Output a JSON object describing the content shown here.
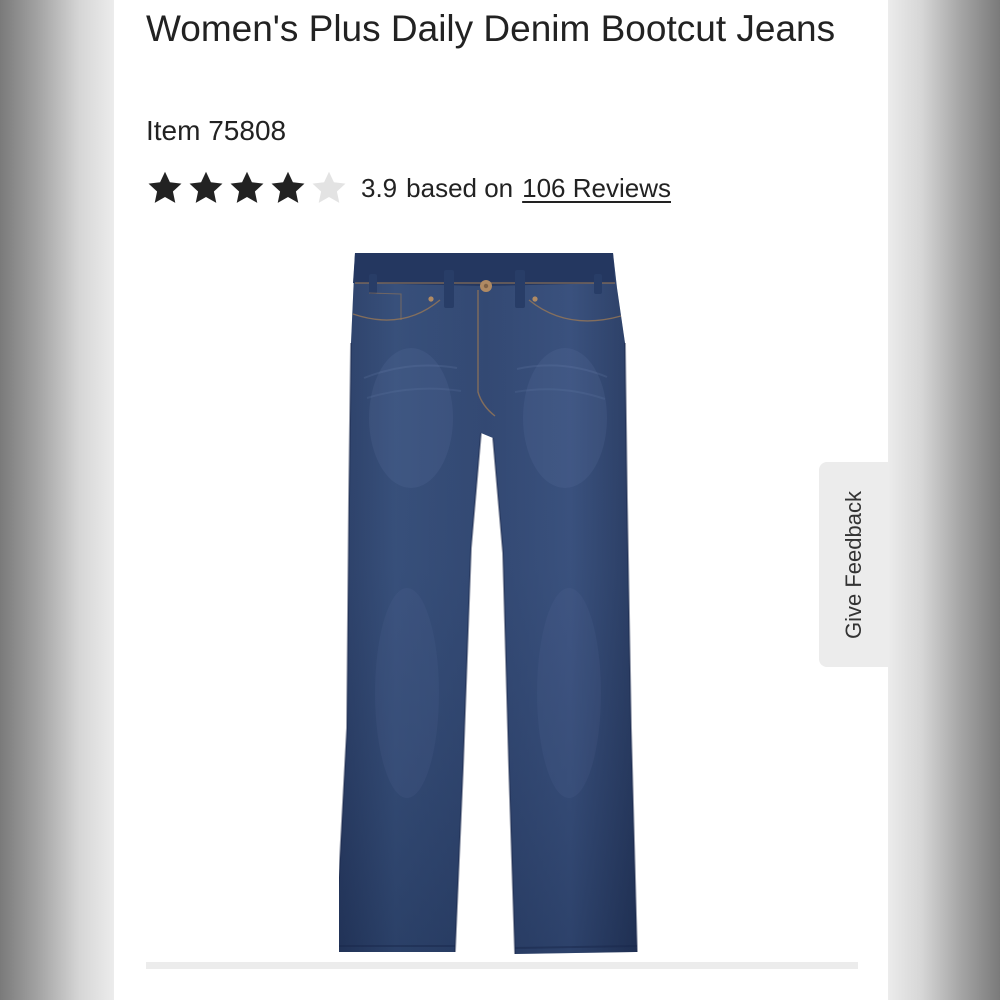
{
  "product": {
    "title": "Women's Plus Daily Denim Bootcut Jeans",
    "item_number": "Item 75808",
    "rating": {
      "stars_total": 5,
      "stars_filled": 4,
      "score": "3.9",
      "based_on_text": "based on",
      "reviews_link": "106 Reviews"
    },
    "image": {
      "description_name": "bootcut-jeans-image"
    }
  },
  "feedback": {
    "label": "Give Feedback"
  },
  "colors": {
    "text": "#222222",
    "star_filled": "#222222",
    "star_empty": "#e3e3e3",
    "denim": "#2f4369",
    "feedback_bg": "#ececec"
  },
  "icons": {
    "star_filled": "star-icon",
    "star_empty": "star-empty-icon"
  }
}
